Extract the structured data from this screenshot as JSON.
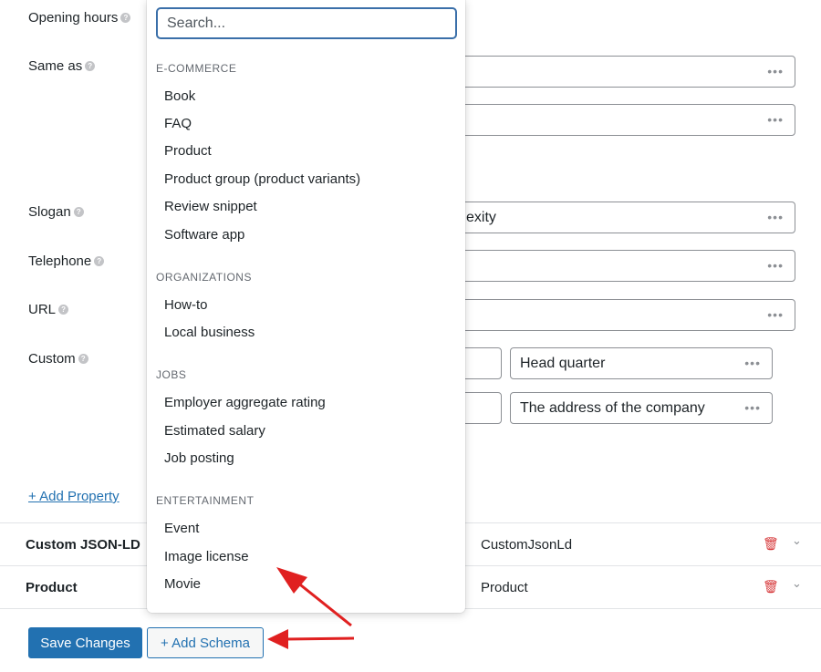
{
  "form": {
    "labels": {
      "opening_hours": "Opening hours",
      "same_as": "Same as",
      "slogan": "Slogan",
      "telephone": "Telephone",
      "url": "URL",
      "custom": "Custom"
    },
    "slogan_value_partial": "exity",
    "custom_row1_value": "Head quarter",
    "custom_row2_value": "The address of the company",
    "dots": "•••",
    "add_property_link": "+ Add Property",
    "help_glyph": "?"
  },
  "schemas": [
    {
      "title": "Custom JSON-LD",
      "type": "CustomJsonLd"
    },
    {
      "title": "Product",
      "type": "Product"
    }
  ],
  "icons": {
    "trash": "🗑",
    "chevron": "⌄"
  },
  "footer": {
    "save_label": "Save Changes",
    "add_schema_label": "+ Add Schema"
  },
  "dropdown": {
    "search_placeholder": "Search...",
    "categories": [
      {
        "name": "E-COMMERCE",
        "items": [
          "Book",
          "FAQ",
          "Product",
          "Product group (product variants)",
          "Review snippet",
          "Software app"
        ]
      },
      {
        "name": "ORGANIZATIONS",
        "items": [
          "How-to",
          "Local business"
        ]
      },
      {
        "name": "JOBS",
        "items": [
          "Employer aggregate rating",
          "Estimated salary",
          "Job posting"
        ]
      },
      {
        "name": "ENTERTAINMENT",
        "items": [
          "Event",
          "Image license",
          "Movie"
        ]
      }
    ]
  },
  "colors": {
    "primary": "#2271b1",
    "danger": "#d63638",
    "annotation_arrow": "#e02020"
  }
}
